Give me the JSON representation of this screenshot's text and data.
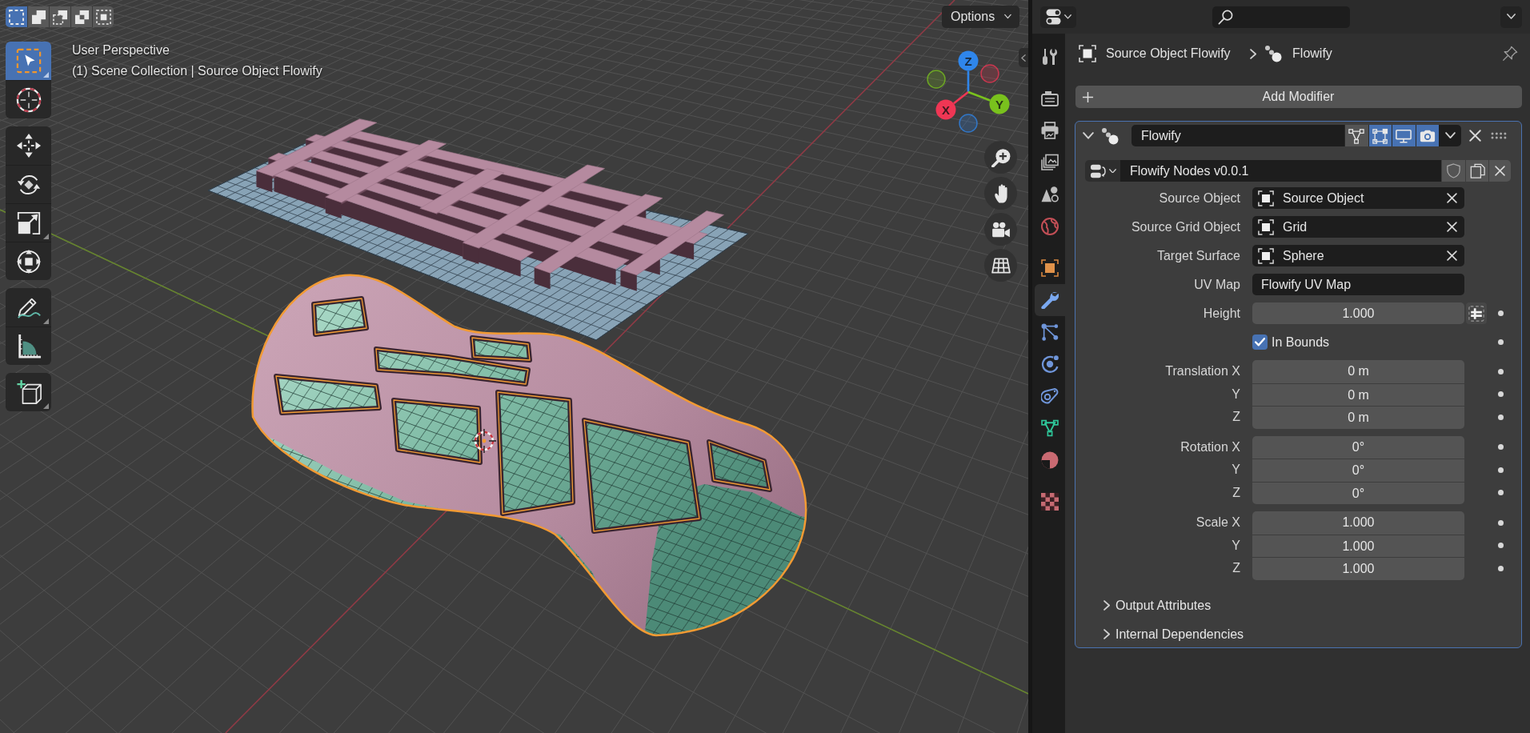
{
  "viewport": {
    "select_modes": [
      {
        "kind": "set",
        "selected": true
      },
      {
        "kind": "extend",
        "selected": false
      },
      {
        "kind": "subtract",
        "selected": false
      },
      {
        "kind": "difference",
        "selected": false
      },
      {
        "kind": "intersect",
        "selected": false
      }
    ],
    "tool_groups": [
      [
        {
          "kind": "select-box",
          "selected": true,
          "variants": true
        },
        {
          "kind": "cursor",
          "selected": false,
          "variants": false
        }
      ],
      [
        {
          "kind": "move",
          "selected": false,
          "variants": false
        },
        {
          "kind": "rotate",
          "selected": false,
          "variants": false
        },
        {
          "kind": "scale",
          "selected": false,
          "variants": true
        },
        {
          "kind": "transform",
          "selected": false,
          "variants": false
        }
      ],
      [
        {
          "kind": "annotate",
          "selected": false,
          "variants": true
        },
        {
          "kind": "measure",
          "selected": false,
          "variants": false
        }
      ],
      [
        {
          "kind": "add-cube",
          "selected": false,
          "variants": true
        }
      ]
    ],
    "view_name": "User Perspective",
    "context": "(1) Scene Collection | Source Object Flowify",
    "options": "Options",
    "gizmo": [
      {
        "label": "Z",
        "color": "#2f86eb"
      },
      {
        "label": "X",
        "color": "#ef3654"
      },
      {
        "label": "Y",
        "color": "#79c11d"
      }
    ]
  },
  "properties": {
    "tab_groups": [
      [
        {
          "kind": "tool",
          "selected": false
        }
      ],
      [
        {
          "kind": "render",
          "selected": false
        },
        {
          "kind": "output",
          "selected": false
        },
        {
          "kind": "view-layer",
          "selected": false
        },
        {
          "kind": "scene",
          "selected": false
        },
        {
          "kind": "world",
          "selected": false
        }
      ],
      [
        {
          "kind": "object",
          "selected": false
        },
        {
          "kind": "modifiers",
          "selected": true
        },
        {
          "kind": "particles",
          "selected": false
        },
        {
          "kind": "physics",
          "selected": false
        },
        {
          "kind": "constraints",
          "selected": false
        },
        {
          "kind": "data",
          "selected": false
        },
        {
          "kind": "material",
          "selected": false
        }
      ],
      [
        {
          "kind": "texture",
          "selected": false
        }
      ]
    ],
    "breadcrumb": [
      {
        "kind": "object",
        "label": "Source Object Flowify"
      },
      {
        "kind": "modifier",
        "label": "Flowify"
      }
    ],
    "add_modifier": "Add Modifier",
    "modifier": {
      "name": "Flowify",
      "expanded": true,
      "toggles": [
        {
          "kind": "edit-mode",
          "on": false
        },
        {
          "kind": "on-cage",
          "on": true
        },
        {
          "kind": "viewport",
          "on": true
        },
        {
          "kind": "render",
          "on": true
        }
      ],
      "node_group": "Flowify Nodes v0.0.1",
      "inputs": [
        {
          "kind": "object",
          "label": "Source Object",
          "value": "Source Object"
        },
        {
          "kind": "object",
          "label": "Source Grid Object",
          "value": "Grid"
        },
        {
          "kind": "object",
          "label": "Target Surface",
          "value": "Sphere"
        },
        {
          "kind": "text",
          "label": "UV Map",
          "value": "Flowify UV Map"
        },
        {
          "kind": "number",
          "label": "Height",
          "value": "1.000"
        },
        {
          "kind": "checkbox",
          "label": "In Bounds",
          "checked": true
        },
        {
          "kind": "vector",
          "fields": [
            {
              "label": "Translation X",
              "value": "0 m"
            },
            {
              "label": "Y",
              "value": "0 m"
            },
            {
              "label": "Z",
              "value": "0 m"
            }
          ]
        },
        {
          "kind": "vector",
          "fields": [
            {
              "label": "Rotation X",
              "value": "0°"
            },
            {
              "label": "Y",
              "value": "0°"
            },
            {
              "label": "Z",
              "value": "0°"
            }
          ]
        },
        {
          "kind": "vector",
          "fields": [
            {
              "label": "Scale X",
              "value": "1.000"
            },
            {
              "label": "Y",
              "value": "1.000"
            },
            {
              "label": "Z",
              "value": "1.000"
            }
          ]
        }
      ],
      "panels": [
        {
          "label": "Output Attributes",
          "expanded": false
        },
        {
          "label": "Internal Dependencies",
          "expanded": false
        }
      ]
    }
  }
}
